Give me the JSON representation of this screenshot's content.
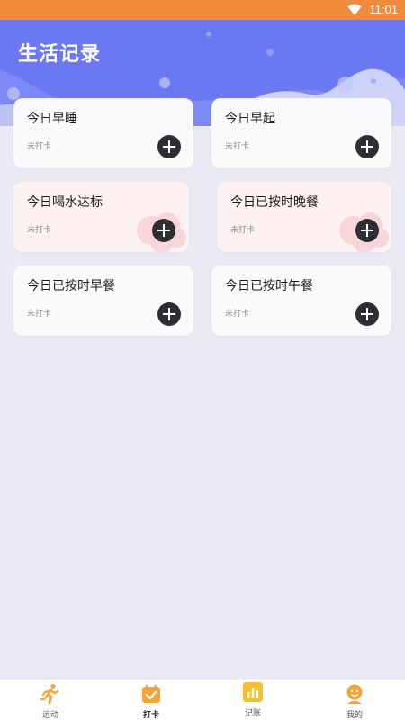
{
  "status_bar": {
    "time": "11:01",
    "icon": "wifi-icon"
  },
  "header": {
    "title": "生活记录"
  },
  "cards": [
    {
      "name": "今日早睡",
      "status": "未打卡",
      "theme": "white"
    },
    {
      "name": "今日早起",
      "status": "未打卡",
      "theme": "white"
    },
    {
      "name": "今日喝水达标",
      "status": "未打卡",
      "theme": "pink"
    },
    {
      "name": "今日已按时晚餐",
      "status": "未打卡",
      "theme": "pink"
    },
    {
      "name": "今日已按时早餐",
      "status": "未打卡",
      "theme": "white"
    },
    {
      "name": "今日已按时午餐",
      "status": "未打卡",
      "theme": "white"
    }
  ],
  "tabbar": {
    "items": [
      {
        "label": "运动",
        "icon": "running-icon"
      },
      {
        "label": "打卡",
        "icon": "checkin-icon",
        "active": true
      },
      {
        "label": "记账",
        "icon": "chart-icon"
      },
      {
        "label": "我的",
        "icon": "profile-icon"
      }
    ]
  },
  "colors": {
    "status_bar": "#f08a3c",
    "header": "#6b78f2",
    "background": "#e8e9f2",
    "accent_orange": "#f5a43a",
    "button_dark": "#2f2f33"
  }
}
